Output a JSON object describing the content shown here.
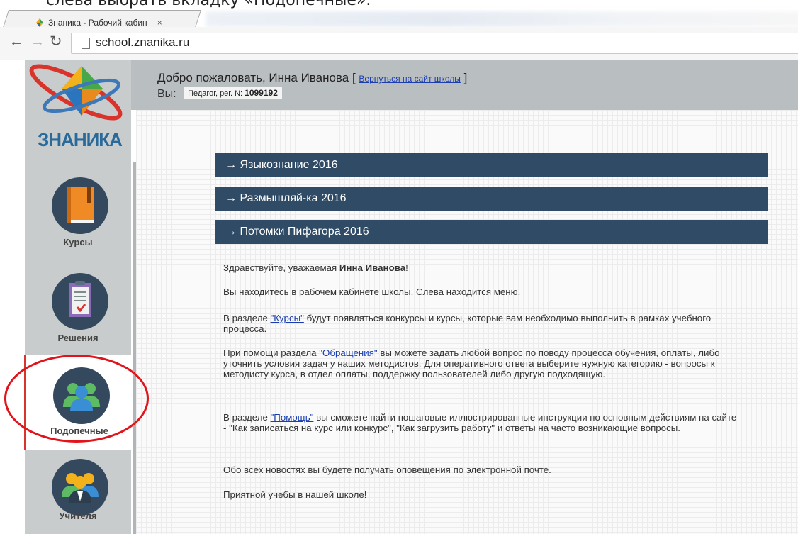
{
  "caption": "слева выбрать вкладку «Подопечные».",
  "browser": {
    "tab_title": "Знаника - Рабочий кабин",
    "tab_close": "×",
    "url": "school.znanika.ru"
  },
  "site": {
    "logo_text": "ЗНАНИКА",
    "welcome_prefix": "Добро пожаловать, Инна Иванова [",
    "back_link": "Вернуться на сайт школы",
    "welcome_suffix": "]",
    "you_label": "Вы:",
    "role": "Педагог, рег. N:",
    "reg_number": "1099192"
  },
  "sidebar": {
    "items": [
      {
        "label": "Курсы",
        "icon": "book-icon"
      },
      {
        "label": "Решения",
        "icon": "clipboard-icon"
      },
      {
        "label": "Подопечные",
        "icon": "people-icon"
      },
      {
        "label": "Учителя",
        "icon": "teachers-icon"
      }
    ]
  },
  "accordion": [
    "→  Языкознание 2016",
    "→  Размышляй-ка 2016",
    "→  Потомки Пифагора 2016"
  ],
  "message": {
    "greeting_prefix": "Здравствуйте, уважаемая ",
    "greeting_name": "Инна Иванова",
    "greeting_suffix": "!",
    "p1": "Вы находитесь в рабочем кабинете школы. Слева находится меню.",
    "p2_prefix": "В разделе ",
    "p2_link": "\"Курсы\"",
    "p2_suffix": " будут появляться конкурсы и курсы, которые вам необходимо выполнить в рамках учебного процесса.",
    "p3_prefix": "При помощи раздела ",
    "p3_link": "\"Обращения\"",
    "p3_suffix": " вы можете задать любой вопрос по поводу процесса обучения, оплаты, либо уточнить условия задач у наших методистов. Для оперативного ответа выберите нужную категорию - вопросы к методисту курса, в отдел оплаты, поддержку пользователей либо другую подходящую.",
    "p4_prefix": "В разделе ",
    "p4_link": "\"Помощь\"",
    "p4_suffix": " вы сможете найти пошаговые иллюстрированные инструкции по основным действиям на сайте - \"Как записаться на курс или конкурс\", \"Как загрузить работу\" и ответы на часто возникающие вопросы.",
    "p5": "Обо всех новостях вы будете получать оповещения по электронной почте.",
    "p6": "Приятной учебы в нашей школе!"
  },
  "colors": {
    "accordion_bg": "#2f4b65",
    "sidebar_bg": "#c9cccd",
    "header_bg": "#b9bec1",
    "annotation_ring": "#e1141b"
  }
}
